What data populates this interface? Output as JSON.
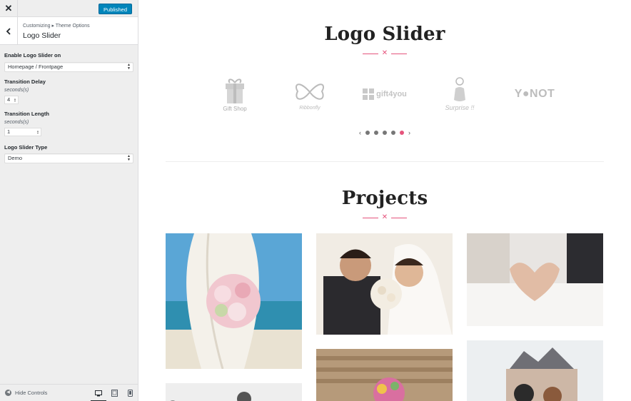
{
  "sidebar": {
    "publish_label": "Published",
    "breadcrumb": "Customizing ▸ Theme Options",
    "section_title": "Logo Slider",
    "controls": {
      "enable_label": "Enable Logo Slider on",
      "enable_value": "Homepage / Frontpage",
      "delay_label": "Transition Delay",
      "delay_desc": "seconds(s)",
      "delay_value": "4",
      "length_label": "Transition Length",
      "length_desc": "seconds(s)",
      "length_value": "1",
      "type_label": "Logo Slider Type",
      "type_value": "Demo"
    },
    "footer": {
      "hide_label": "Hide Controls"
    }
  },
  "preview": {
    "logo_section_title": "Logo Slider",
    "projects_title": "Projects",
    "logos": [
      {
        "name": "gift-shop",
        "text": "Gift Shop"
      },
      {
        "name": "ribbonfly",
        "text": "Ribbonfly"
      },
      {
        "name": "gift4you",
        "text": "gift4you"
      },
      {
        "name": "surprise",
        "text": "Surprise !!"
      },
      {
        "name": "ynot",
        "text": "Y●NOT"
      }
    ],
    "active_dot": 5,
    "accent_color": "#e5547c"
  }
}
